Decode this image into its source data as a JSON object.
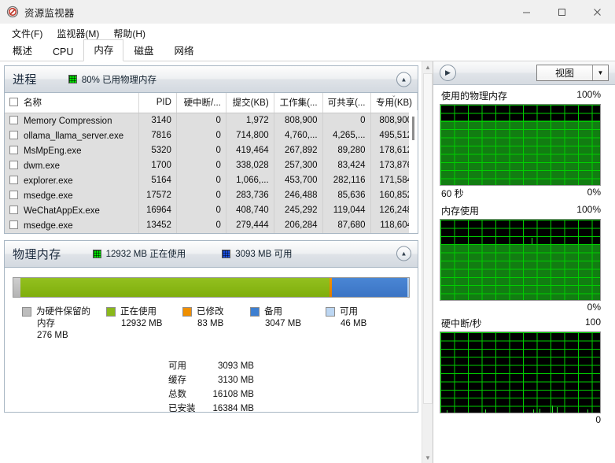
{
  "window": {
    "title": "资源监视器",
    "icon": "resource-monitor-icon",
    "minimize": "—",
    "maximize": "□",
    "close": "✕"
  },
  "menubar": [
    {
      "label": "文件(F)"
    },
    {
      "label": "监视器(M)"
    },
    {
      "label": "帮助(H)"
    }
  ],
  "tabs": [
    {
      "label": "概述",
      "active": false
    },
    {
      "label": "CPU",
      "active": false
    },
    {
      "label": "内存",
      "active": true
    },
    {
      "label": "磁盘",
      "active": false
    },
    {
      "label": "网络",
      "active": false
    }
  ],
  "processes_panel": {
    "title": "进程",
    "stat_label": "80% 已用物理内存",
    "collapse_icon": "chevron-up-icon",
    "columns": [
      {
        "label": "名称",
        "align": "left"
      },
      {
        "label": "PID",
        "align": "right"
      },
      {
        "label": "硬中断/...",
        "align": "right"
      },
      {
        "label": "提交(KB)",
        "align": "right"
      },
      {
        "label": "工作集(...",
        "align": "right"
      },
      {
        "label": "可共享(...",
        "align": "right"
      },
      {
        "label": "专用(KB)",
        "align": "right",
        "sorted": "desc"
      }
    ],
    "rows": [
      {
        "name": "Memory Compression",
        "pid": "3140",
        "hard_faults": "0",
        "commit": "1,972",
        "working_set": "808,900",
        "shareable": "0",
        "private": "808,900"
      },
      {
        "name": "ollama_llama_server.exe",
        "pid": "7816",
        "hard_faults": "0",
        "commit": "714,800",
        "working_set": "4,760,...",
        "shareable": "4,265,...",
        "private": "495,512"
      },
      {
        "name": "MsMpEng.exe",
        "pid": "5320",
        "hard_faults": "0",
        "commit": "419,464",
        "working_set": "267,892",
        "shareable": "89,280",
        "private": "178,612"
      },
      {
        "name": "dwm.exe",
        "pid": "1700",
        "hard_faults": "0",
        "commit": "338,028",
        "working_set": "257,300",
        "shareable": "83,424",
        "private": "173,876"
      },
      {
        "name": "explorer.exe",
        "pid": "5164",
        "hard_faults": "0",
        "commit": "1,066,...",
        "working_set": "453,700",
        "shareable": "282,116",
        "private": "171,584"
      },
      {
        "name": "msedge.exe",
        "pid": "17572",
        "hard_faults": "0",
        "commit": "283,736",
        "working_set": "246,488",
        "shareable": "85,636",
        "private": "160,852"
      },
      {
        "name": "WeChatAppEx.exe",
        "pid": "16964",
        "hard_faults": "0",
        "commit": "408,740",
        "working_set": "245,292",
        "shareable": "119,044",
        "private": "126,248"
      },
      {
        "name": "msedge.exe",
        "pid": "13452",
        "hard_faults": "0",
        "commit": "279,444",
        "working_set": "206,284",
        "shareable": "87,680",
        "private": "118,604"
      }
    ]
  },
  "memory_panel": {
    "title": "物理内存",
    "stat_in_use": "12932 MB 正在使用",
    "stat_available": "3093 MB 可用",
    "collapse_icon": "chevron-up-icon",
    "bar_segments": [
      {
        "key": "hardware_reserved",
        "percent": 1.7,
        "color": "#c2c2c2"
      },
      {
        "key": "in_use",
        "percent": 78.3,
        "color": "#8ab81a"
      },
      {
        "key": "modified",
        "percent": 0.5,
        "color": "#ef8f00"
      },
      {
        "key": "standby",
        "percent": 19.2,
        "color": "#4280cf"
      },
      {
        "key": "free",
        "percent": 0.3,
        "color": "#b4cfee"
      }
    ],
    "legend": [
      {
        "label": "为硬件保留的",
        "label2": "内存",
        "value": "276 MB",
        "color": "#bdbdbd"
      },
      {
        "label": "正在使用",
        "label2": "",
        "value": "12932 MB",
        "color": "#8ab81a"
      },
      {
        "label": "已修改",
        "label2": "",
        "value": "83 MB",
        "color": "#ef8f00"
      },
      {
        "label": "备用",
        "label2": "",
        "value": "3047 MB",
        "color": "#3d7fd1"
      },
      {
        "label": "可用",
        "label2": "",
        "value": "46 MB",
        "color": "#bcd6f2"
      }
    ],
    "summary": [
      {
        "key": "可用",
        "value": "3093 MB"
      },
      {
        "key": "缓存",
        "value": "3130 MB"
      },
      {
        "key": "总数",
        "value": "16108 MB"
      },
      {
        "key": "已安装",
        "value": "16384 MB"
      }
    ]
  },
  "right_panel": {
    "expand_icon": "chevron-right-icon",
    "view_button": "视图",
    "view_arrow": "▼",
    "graphs": [
      {
        "title": "使用的物理内存",
        "max_label": "100%",
        "min_label": "0%",
        "time_label": "60 秒",
        "fill_percent": 80,
        "spikes": []
      },
      {
        "title": "内存使用",
        "max_label": "100%",
        "min_label": "0%",
        "time_label": "",
        "fill_percent": 70,
        "spikes": [
          {
            "x": 57,
            "height": 8
          }
        ]
      },
      {
        "title": "硬中断/秒",
        "max_label": "100",
        "min_label": "0",
        "time_label": "",
        "fill_percent": 0,
        "spikes": [
          {
            "x": 4,
            "height": 3
          },
          {
            "x": 28,
            "height": 4
          },
          {
            "x": 58,
            "height": 4
          },
          {
            "x": 62,
            "height": 5
          },
          {
            "x": 70,
            "height": 9
          },
          {
            "x": 73,
            "height": 7
          },
          {
            "x": 92,
            "height": 4
          }
        ]
      }
    ]
  },
  "chart_data": [
    {
      "type": "area",
      "title": "使用的物理内存",
      "ylabel": "",
      "xlabel": "60 秒",
      "ylim": [
        0,
        100
      ],
      "y_tick_labels": [
        "0%",
        "100%"
      ],
      "values": [
        80,
        80,
        80,
        80,
        80,
        80,
        80,
        80,
        80,
        80,
        80,
        80
      ],
      "grid": true
    },
    {
      "type": "area",
      "title": "内存使用",
      "ylabel": "",
      "xlabel": "",
      "ylim": [
        0,
        100
      ],
      "y_tick_labels": [
        "0%",
        "100%"
      ],
      "values": [
        70,
        70,
        70,
        70,
        70,
        70,
        78,
        70,
        70,
        70,
        70,
        70
      ],
      "grid": true
    },
    {
      "type": "line",
      "title": "硬中断/秒",
      "ylabel": "",
      "xlabel": "",
      "ylim": [
        0,
        100
      ],
      "y_tick_labels": [
        "0",
        "100"
      ],
      "values": [
        3,
        0,
        0,
        4,
        0,
        0,
        0,
        4,
        5,
        9,
        7,
        4
      ],
      "grid": true
    }
  ]
}
